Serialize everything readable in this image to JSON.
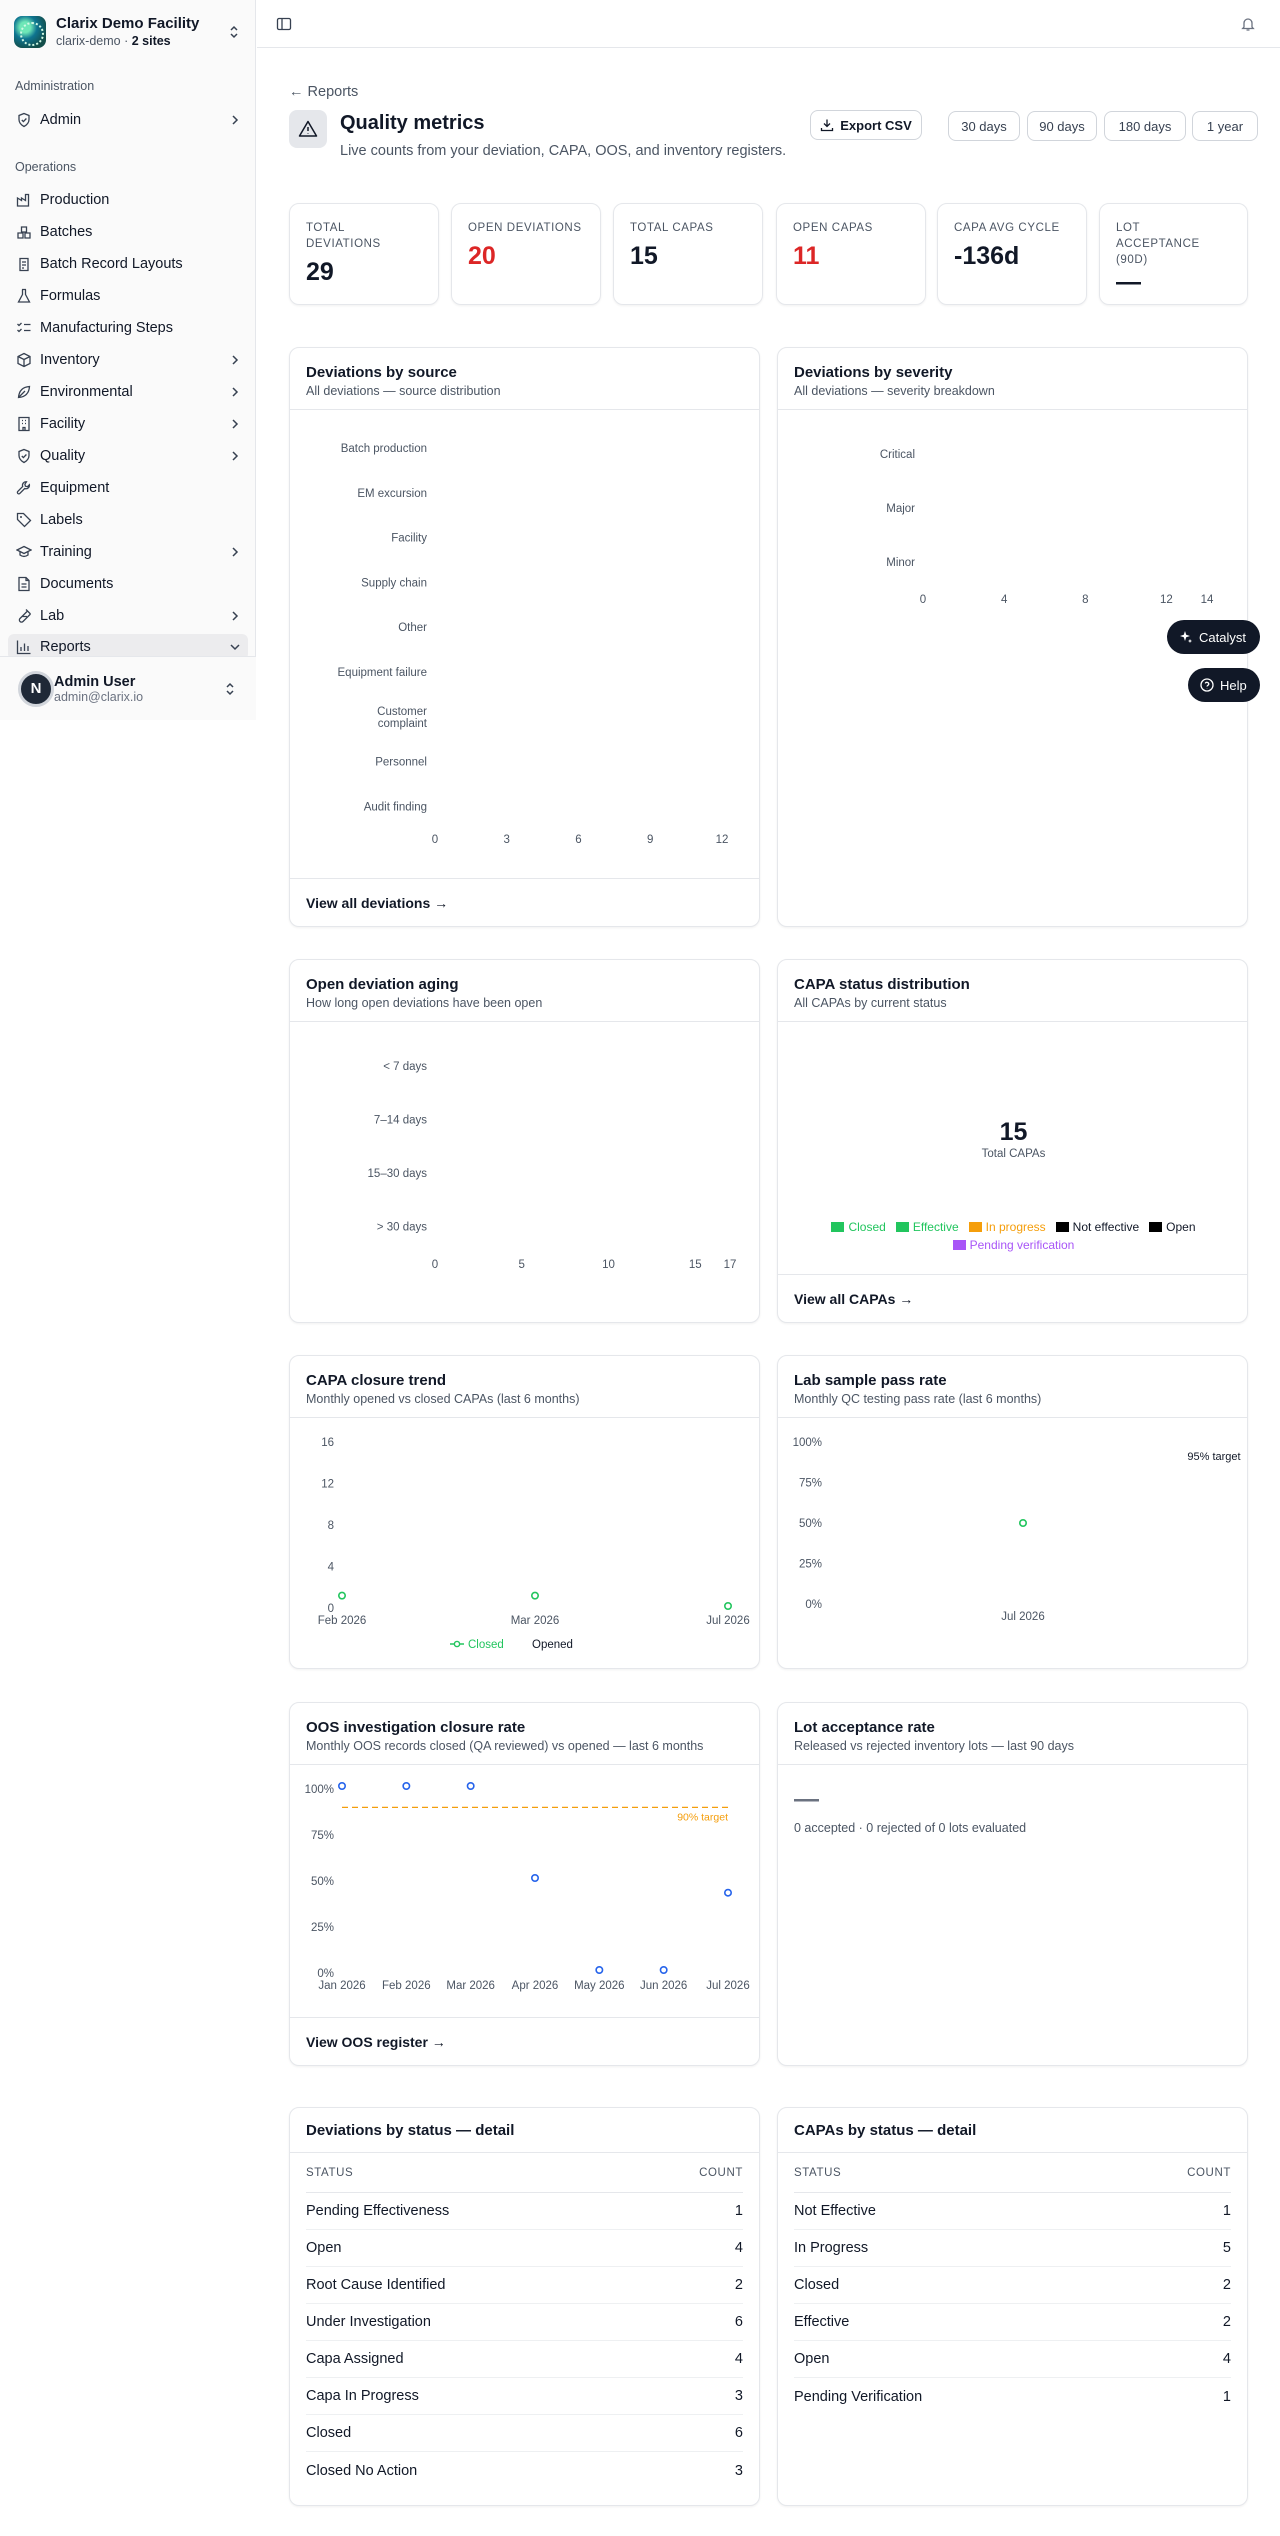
{
  "org": {
    "name": "Clarix Demo Facility",
    "slug": "clarix-demo · ",
    "sites": "2 sites"
  },
  "sidebar": {
    "admin_section": "Administration",
    "ops_section": "Operations",
    "admin_item": "Admin",
    "items": [
      {
        "label": "Production"
      },
      {
        "label": "Batches"
      },
      {
        "label": "Batch Record Layouts"
      },
      {
        "label": "Formulas"
      },
      {
        "label": "Manufacturing Steps"
      },
      {
        "label": "Inventory"
      },
      {
        "label": "Environmental"
      },
      {
        "label": "Facility"
      },
      {
        "label": "Quality"
      },
      {
        "label": "Equipment"
      },
      {
        "label": "Labels"
      },
      {
        "label": "Training"
      },
      {
        "label": "Documents"
      },
      {
        "label": "Lab"
      },
      {
        "label": "Reports"
      }
    ]
  },
  "user": {
    "initial": "N",
    "name": "Admin User",
    "email": "admin@clarix.io"
  },
  "header": {
    "back": "← Reports",
    "title": "Quality metrics",
    "subtitle": "Live counts from your deviation, CAPA, OOS, and inventory registers.",
    "export": "Export CSV",
    "ranges": [
      "30 days",
      "90 days",
      "180 days",
      "1 year"
    ]
  },
  "kpis": [
    {
      "label": "TOTAL DEVIATIONS",
      "value": "29"
    },
    {
      "label": "OPEN DEVIATIONS",
      "value": "20"
    },
    {
      "label": "TOTAL CAPAS",
      "value": "15"
    },
    {
      "label": "OPEN CAPAS",
      "value": "11"
    },
    {
      "label": "CAPA AVG CYCLE",
      "value": "-136d"
    },
    {
      "label": "LOT ACCEPTANCE (90D)",
      "value": "—"
    }
  ],
  "float": {
    "catalyst": "Catalyst",
    "help": "Help"
  },
  "panels": {
    "dev_source": {
      "title": "Deviations by source",
      "sub": "All deviations — source distribution",
      "foot": "View all deviations →"
    },
    "dev_severity": {
      "title": "Deviations by severity",
      "sub": "All deviations — severity breakdown"
    },
    "aging": {
      "title": "Open deviation aging",
      "sub": "How long open deviations have been open"
    },
    "capa_status": {
      "title": "CAPA status distribution",
      "sub": "All CAPAs by current status",
      "foot": "View all CAPAs →",
      "total": "15",
      "total_label": "Total CAPAs"
    },
    "capa_trend": {
      "title": "CAPA closure trend",
      "sub": "Monthly opened vs closed CAPAs (last 6 months)"
    },
    "lab_pass": {
      "title": "Lab sample pass rate",
      "sub": "Monthly QC testing pass rate (last 6 months)"
    },
    "oos": {
      "title": "OOS investigation closure rate",
      "sub": "Monthly OOS records closed (QA reviewed) vs opened — last 6 months",
      "foot": "View OOS register →"
    },
    "lot": {
      "title": "Lot acceptance rate",
      "sub": "Released vs rejected inventory lots — last 90 days",
      "value": "—",
      "note": "0 accepted · 0 rejected of 0 lots evaluated"
    },
    "dev_table": {
      "title": "Deviations by status — detail"
    },
    "capa_table": {
      "title": "CAPAs by status — detail"
    }
  },
  "chart_data": [
    {
      "type": "bar",
      "title": "Deviations by source",
      "orientation": "horizontal",
      "categories": [
        "Batch production",
        "EM excursion",
        "Facility",
        "Supply chain",
        "Other",
        "Equipment failure",
        "Customer complaint",
        "Personnel",
        "Audit finding"
      ],
      "values": [
        0,
        0,
        0,
        0,
        0,
        0,
        0,
        0,
        0
      ],
      "xticks": [
        "0",
        "3",
        "6",
        "9",
        "12"
      ],
      "xlim": [
        0,
        12
      ]
    },
    {
      "type": "bar",
      "title": "Deviations by severity",
      "orientation": "horizontal",
      "categories": [
        "Critical",
        "Major",
        "Minor"
      ],
      "values": [
        0,
        0,
        0
      ],
      "xticks": [
        "0",
        "4",
        "8",
        "12",
        "14"
      ],
      "xlim": [
        0,
        14
      ]
    },
    {
      "type": "bar",
      "title": "Open deviation aging",
      "orientation": "horizontal",
      "categories": [
        "< 7 days",
        "7–14 days",
        "15–30 days",
        "> 30 days"
      ],
      "values": [
        0,
        0,
        0,
        0
      ],
      "xticks": [
        "0",
        "5",
        "10",
        "15",
        "17"
      ],
      "xlim": [
        0,
        17
      ]
    },
    {
      "type": "pie",
      "title": "CAPA status distribution",
      "legend": [
        {
          "name": "Closed",
          "color": "#22c55e"
        },
        {
          "name": "Effective",
          "color": "#22c55e"
        },
        {
          "name": "In progress",
          "color": "#f59e0b"
        },
        {
          "name": "Not effective",
          "color": "#000000"
        },
        {
          "name": "Open",
          "color": "#000000"
        },
        {
          "name": "Pending verification",
          "color": "#a855f7"
        }
      ]
    },
    {
      "type": "line",
      "title": "CAPA closure trend",
      "x": [
        "Feb 2026",
        "Mar 2026",
        "Jul 2026"
      ],
      "ylim": [
        0,
        16
      ],
      "yticks": [
        "0",
        "4",
        "8",
        "12",
        "16"
      ],
      "series": [
        {
          "name": "Closed",
          "color": "#22c55e",
          "values": [
            1,
            1,
            0
          ]
        },
        {
          "name": "Opened",
          "color": "#111827",
          "values": []
        }
      ]
    },
    {
      "type": "scatter",
      "title": "Lab sample pass rate",
      "x": [
        "Jul 2026"
      ],
      "ylim": [
        0,
        100
      ],
      "yticks": [
        "0%",
        "25%",
        "50%",
        "75%",
        "100%"
      ],
      "target_label": "95% target",
      "series": [
        {
          "name": "Pass rate",
          "color": "#22c55e",
          "values": [
            50
          ]
        }
      ]
    },
    {
      "type": "line",
      "title": "OOS investigation closure rate",
      "x": [
        "Jan 2026",
        "Feb 2026",
        "Mar 2026",
        "Apr 2026",
        "May 2026",
        "Jun 2026",
        "Jul 2026"
      ],
      "ylim": [
        0,
        100
      ],
      "yticks": [
        "0%",
        "25%",
        "50%",
        "75%",
        "100%"
      ],
      "target_label": "90% target",
      "target_value": 90,
      "series": [
        {
          "name": "Closure rate",
          "color": "#2563eb",
          "values": [
            100,
            100,
            100,
            50,
            0,
            0,
            42
          ]
        }
      ]
    }
  ],
  "dev_table": {
    "col_status": "STATUS",
    "col_count": "COUNT",
    "rows": [
      {
        "status": "Pending Effectiveness",
        "count": "1"
      },
      {
        "status": "Open",
        "count": "4"
      },
      {
        "status": "Root Cause Identified",
        "count": "2"
      },
      {
        "status": "Under Investigation",
        "count": "6"
      },
      {
        "status": "Capa Assigned",
        "count": "4"
      },
      {
        "status": "Capa In Progress",
        "count": "3"
      },
      {
        "status": "Closed",
        "count": "6"
      },
      {
        "status": "Closed No Action",
        "count": "3"
      }
    ]
  },
  "capa_table": {
    "col_status": "STATUS",
    "col_count": "COUNT",
    "rows": [
      {
        "status": "Not Effective",
        "count": "1"
      },
      {
        "status": "In Progress",
        "count": "5"
      },
      {
        "status": "Closed",
        "count": "2"
      },
      {
        "status": "Effective",
        "count": "2"
      },
      {
        "status": "Open",
        "count": "4"
      },
      {
        "status": "Pending Verification",
        "count": "1"
      }
    ]
  }
}
